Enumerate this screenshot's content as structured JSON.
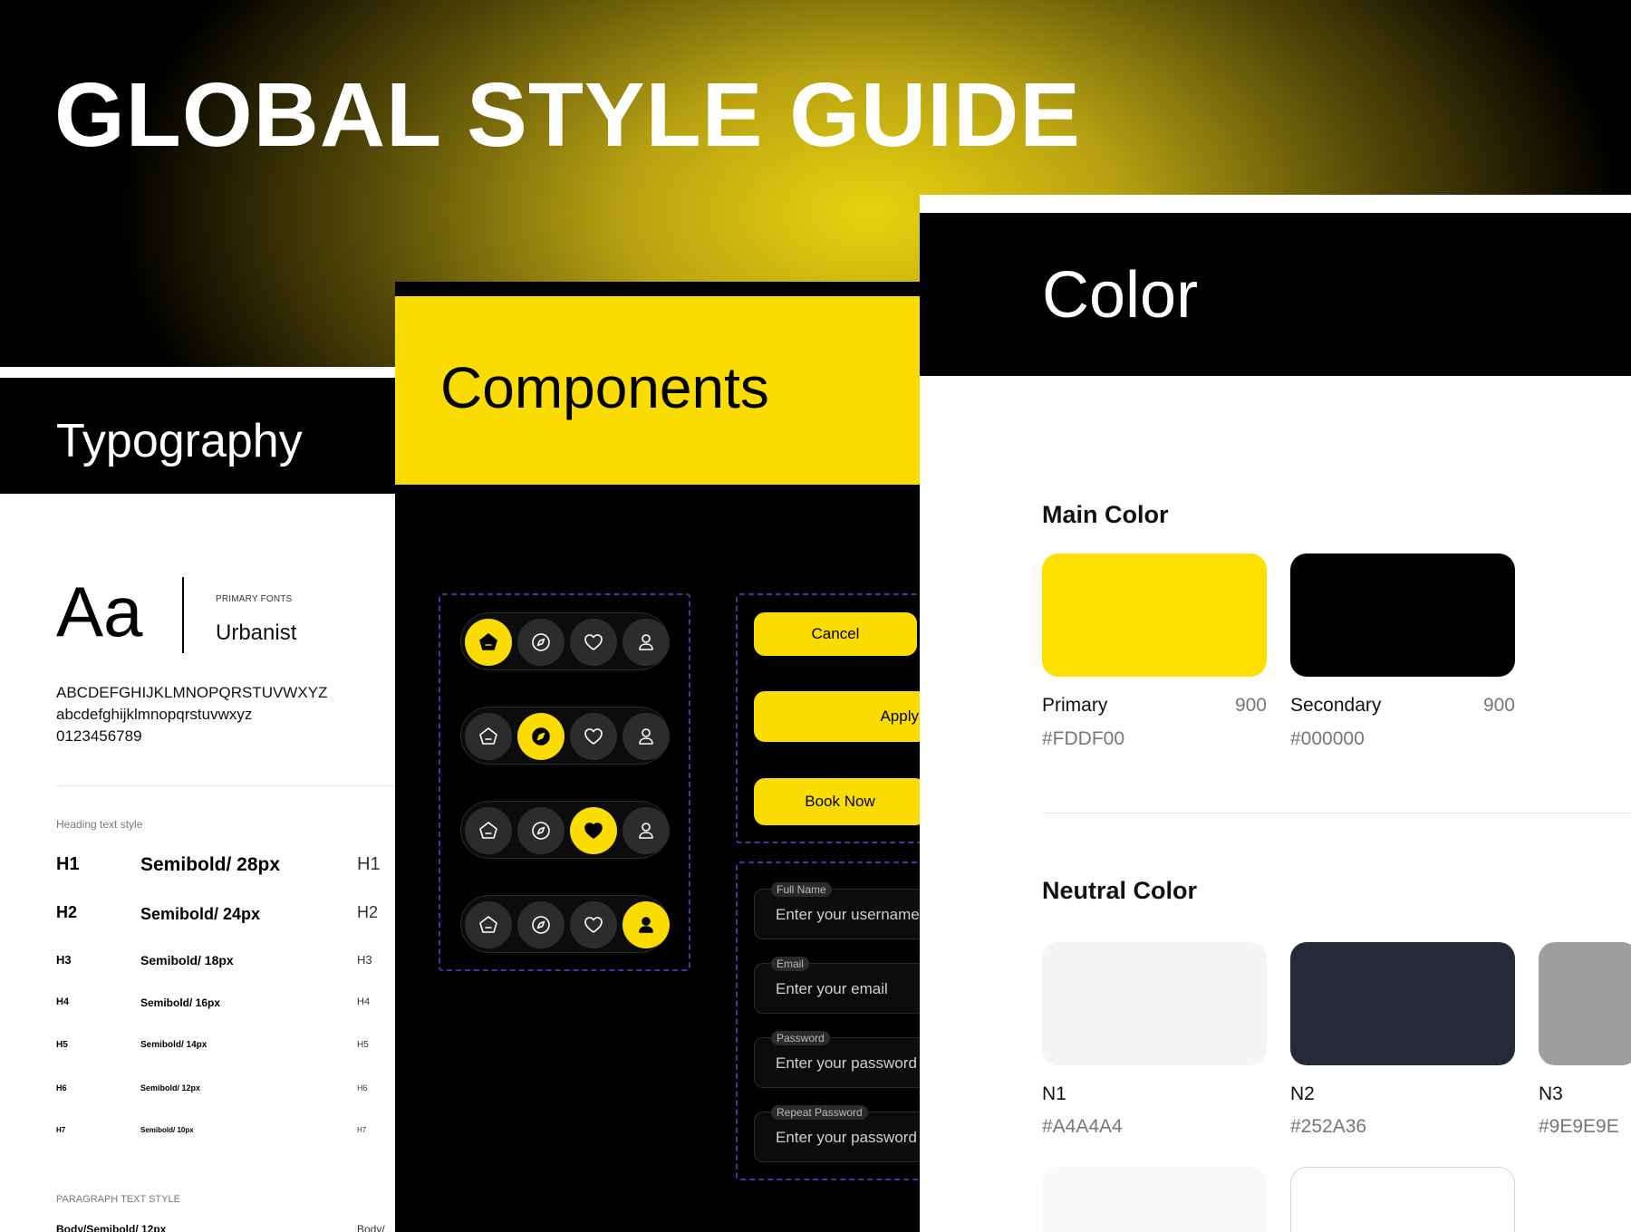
{
  "title": "GLOBAL STYLE GUIDE",
  "typography": {
    "title": "Typography",
    "sample": "Aa",
    "primary_fonts_label": "PRIMARY FONTS",
    "font_name": "Urbanist",
    "uppercase": "ABCDEFGHIJKLMNOPQRSTUVWXYZ",
    "lowercase": "abcdefghijklmnopqrstuvwxyz",
    "digits": "0123456789",
    "heading_caption": "Heading text style",
    "headings": [
      {
        "name": "H1",
        "style": "Semibold/ 28px",
        "sample": "H1"
      },
      {
        "name": "H2",
        "style": "Semibold/ 24px",
        "sample": "H2"
      },
      {
        "name": "H3",
        "style": "Semibold/ 18px",
        "sample": "H3"
      },
      {
        "name": "H4",
        "style": "Semibold/ 16px",
        "sample": "H4"
      },
      {
        "name": "H5",
        "style": "Semibold/ 14px",
        "sample": "H5"
      },
      {
        "name": "H6",
        "style": "Semibold/ 12px",
        "sample": "H6"
      },
      {
        "name": "H7",
        "style": "Semibold/ 10px",
        "sample": "H7"
      }
    ],
    "paragraph_caption": "PARAGRAPH TEXT STYLE",
    "paragraph_first": "Body/Semibold/ 12px",
    "paragraph_first_sample": "Body/"
  },
  "components": {
    "title": "Components",
    "nav_icons": [
      "home-icon",
      "compass-icon",
      "heart-icon",
      "user-icon"
    ],
    "nav_active": [
      0,
      1,
      2,
      3
    ],
    "buttons": {
      "cancel": "Cancel",
      "apply": "Apply",
      "book": "Book Now"
    },
    "fields": [
      {
        "label": "Full Name",
        "placeholder": "Enter your username"
      },
      {
        "label": "Email",
        "placeholder": "Enter your email"
      },
      {
        "label": "Password",
        "placeholder": "Enter your password"
      },
      {
        "label": "Repeat Password",
        "placeholder": "Enter your password"
      }
    ]
  },
  "color": {
    "title": "Color",
    "main_heading": "Main Color",
    "main": [
      {
        "name": "Primary",
        "weight": "900",
        "hex": "#FDDF00",
        "swatch": "#FDDF00"
      },
      {
        "name": "Secondary",
        "weight": "900",
        "hex": "#000000",
        "swatch": "#000000"
      }
    ],
    "neutral_heading": "Neutral Color",
    "neutral": [
      {
        "name": "N1",
        "hex": "#A4A4A4",
        "swatch": "#F4F4F4"
      },
      {
        "name": "N2",
        "hex": "#252A36",
        "swatch": "#252A36"
      },
      {
        "name": "N3",
        "hex": "#9E9E9E",
        "swatch": "#9E9E9E"
      }
    ],
    "extra_swatches": [
      "#F8F9FB",
      "#FFFFFF"
    ]
  }
}
